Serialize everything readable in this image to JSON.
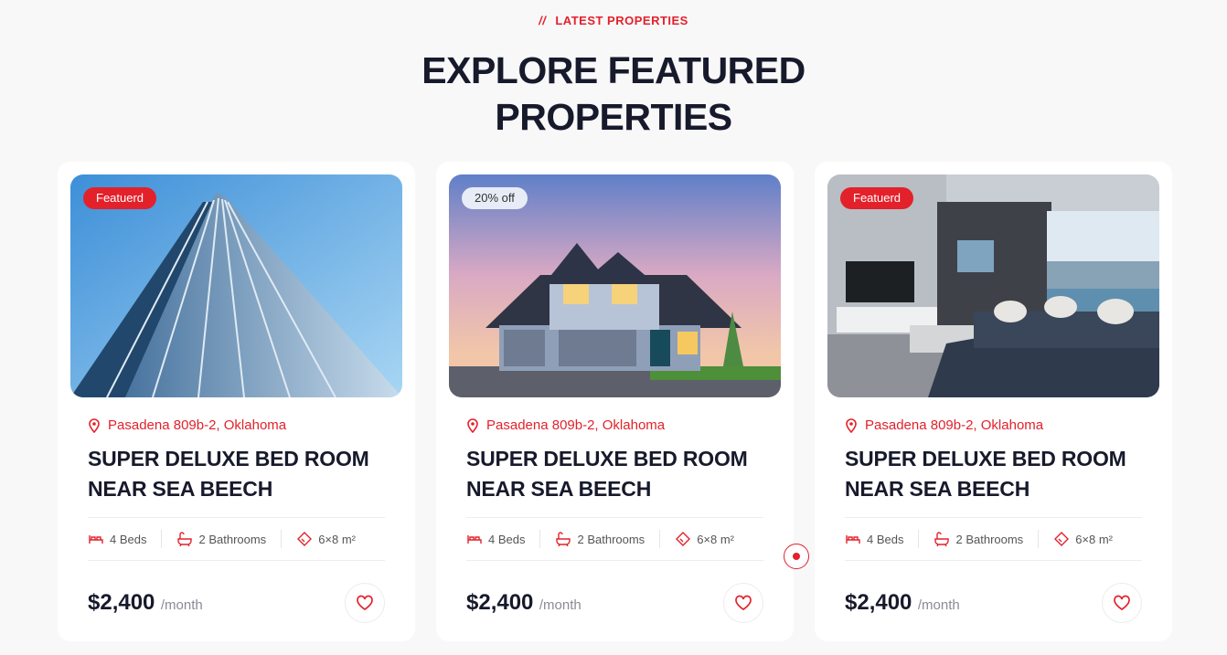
{
  "section": {
    "eyebrow_slashes": "//",
    "eyebrow": "LATEST PROPERTIES",
    "headline_line1": "EXPLORE FEATURED",
    "headline_line2": "PROPERTIES"
  },
  "colors": {
    "accent": "#e3212b",
    "heading": "#171a2b",
    "background": "#f8f8f9"
  },
  "cards": [
    {
      "badge": "Featuerd",
      "image": "glass-office-tower",
      "location": "Pasadena 809b-2, Oklahoma",
      "title": "SUPER DELUXE BED ROOM NEAR SEA BEECH",
      "beds": "4 Beds",
      "baths": "2 Bathrooms",
      "area": "6×8 m²",
      "price": "$2,400",
      "period": "/month"
    },
    {
      "badge": "20% off",
      "image": "suburban-house-at-dusk",
      "location": "Pasadena 809b-2, Oklahoma",
      "title": "SUPER DELUXE BED ROOM NEAR SEA BEECH",
      "beds": "4 Beds",
      "baths": "2 Bathrooms",
      "area": "6×8 m²",
      "price": "$2,400",
      "period": "/month"
    },
    {
      "badge": "Featuerd",
      "image": "modern-living-room",
      "location": "Pasadena 809b-2, Oklahoma",
      "title": "SUPER DELUXE BED ROOM NEAR SEA BEECH",
      "beds": "4 Beds",
      "baths": "2 Bathrooms",
      "area": "6×8 m²",
      "price": "$2,400",
      "period": "/month"
    }
  ],
  "icons": {
    "location": "map-pin-icon",
    "beds": "bed-icon",
    "baths": "bathtub-icon",
    "area": "area-icon",
    "favorite": "heart-icon"
  }
}
